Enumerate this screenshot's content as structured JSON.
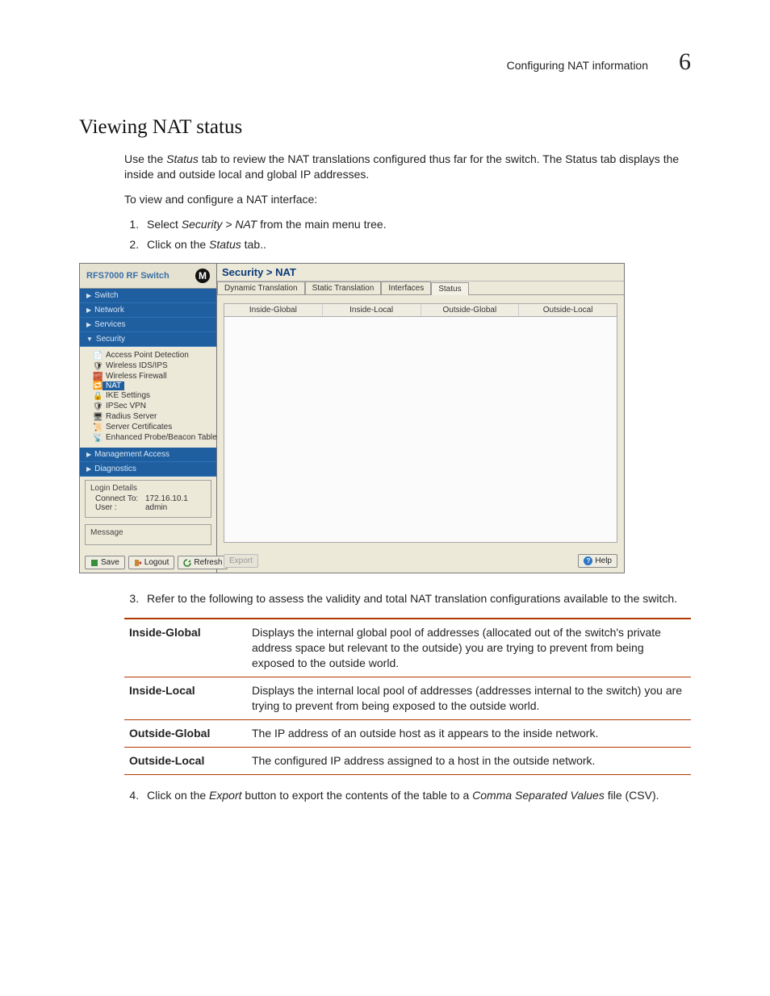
{
  "header": {
    "running": "Configuring NAT information",
    "chapter": "6"
  },
  "title": "Viewing NAT status",
  "intro1a": "Use the ",
  "intro1b": "Status",
  "intro1c": " tab to review the NAT translations configured thus far for the switch. The Status tab displays the inside and outside local and global IP addresses.",
  "intro2": "To view and configure a NAT interface:",
  "step1a": "Select ",
  "step1b": "Security > NAT",
  "step1c": " from the main menu tree.",
  "step2a": "Click on the ",
  "step2b": "Status",
  "step2c": " tab..",
  "shot": {
    "product": "RFS7000 RF Switch",
    "nav": [
      "Switch",
      "Network",
      "Services",
      "Security"
    ],
    "tree": [
      "Access Point Detection",
      "Wireless IDS/IPS",
      "Wireless Firewall",
      "NAT",
      "IKE Settings",
      "IPSec VPN",
      "Radius Server",
      "Server Certificates",
      "Enhanced Probe/Beacon Table"
    ],
    "nav2": [
      "Management Access",
      "Diagnostics"
    ],
    "login": {
      "title": "Login Details",
      "connect_lbl": "Connect To:",
      "connect_val": "172.16.10.1",
      "user_lbl": "User :",
      "user_val": "admin"
    },
    "message": "Message",
    "btns": {
      "save": "Save",
      "logout": "Logout",
      "refresh": "Refresh",
      "export": "Export",
      "help": "Help"
    },
    "crumb": "Security > NAT",
    "tabs": [
      "Dynamic Translation",
      "Static Translation",
      "Interfaces",
      "Status"
    ],
    "cols": [
      "Inside-Global",
      "Inside-Local",
      "Outside-Global",
      "Outside-Local"
    ]
  },
  "step3": "Refer to the following to assess the validity and total NAT translation configurations available to the switch.",
  "def": [
    {
      "term": "Inside-Global",
      "desc": "Displays the internal global pool of addresses (allocated out of the switch's private address space but relevant to the outside) you are trying to prevent from being exposed to the outside world."
    },
    {
      "term": "Inside-Local",
      "desc": "Displays the internal local pool of addresses (addresses internal to the switch) you are trying to prevent from being exposed to the outside world."
    },
    {
      "term": "Outside-Global",
      "desc": "The IP address of an outside host as it appears to the inside network."
    },
    {
      "term": "Outside-Local",
      "desc": "The configured IP address assigned to a host in the outside network."
    }
  ],
  "step4a": "Click on the ",
  "step4b": "Export",
  "step4c": " button to export the contents of the table to a ",
  "step4d": "Comma Separated Values",
  "step4e": " file (CSV)."
}
